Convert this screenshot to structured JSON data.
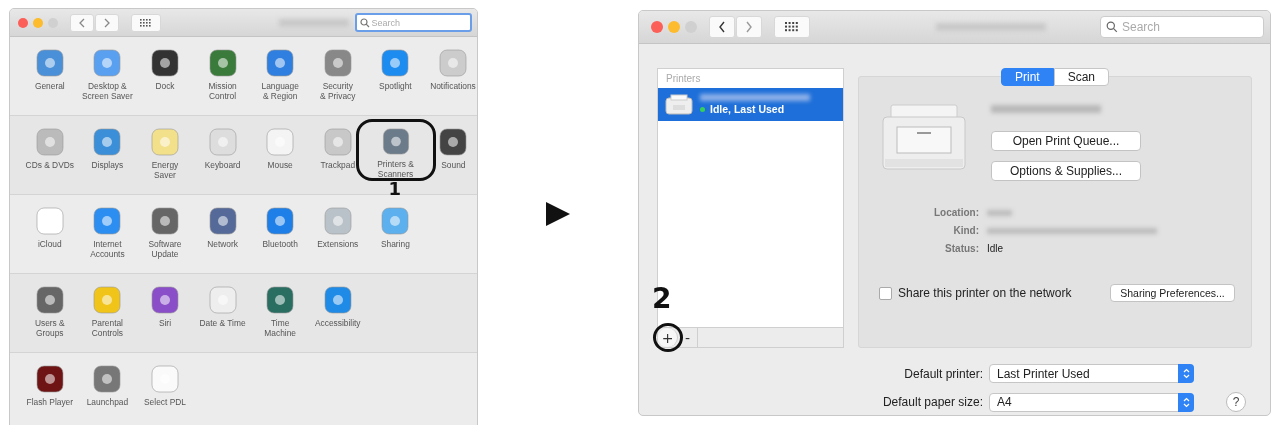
{
  "system_preferences": {
    "search": {
      "placeholder": "Search",
      "focused": true
    },
    "sections": [
      {
        "items": [
          {
            "label": "General",
            "highlighted": false
          },
          {
            "label": "Desktop &\nScreen Saver",
            "highlighted": false
          },
          {
            "label": "Dock",
            "highlighted": false
          },
          {
            "label": "Mission\nControl",
            "highlighted": false
          },
          {
            "label": "Language\n& Region",
            "highlighted": false
          },
          {
            "label": "Security\n& Privacy",
            "highlighted": false
          },
          {
            "label": "Spotlight",
            "highlighted": false
          },
          {
            "label": "Notifications",
            "highlighted": false
          }
        ]
      },
      {
        "items": [
          {
            "label": "CDs & DVDs",
            "highlighted": false
          },
          {
            "label": "Displays",
            "highlighted": false
          },
          {
            "label": "Energy\nSaver",
            "highlighted": false
          },
          {
            "label": "Keyboard",
            "highlighted": false
          },
          {
            "label": "Mouse",
            "highlighted": false
          },
          {
            "label": "Trackpad",
            "highlighted": false
          },
          {
            "label": "Printers &\nScanners",
            "highlighted": true,
            "callout": "1"
          },
          {
            "label": "Sound",
            "highlighted": false
          }
        ]
      },
      {
        "items": [
          {
            "label": "iCloud",
            "highlighted": false
          },
          {
            "label": "Internet\nAccounts",
            "highlighted": false
          },
          {
            "label": "Software\nUpdate",
            "highlighted": false
          },
          {
            "label": "Network",
            "highlighted": false
          },
          {
            "label": "Bluetooth",
            "highlighted": false
          },
          {
            "label": "Extensions",
            "highlighted": false
          },
          {
            "label": "Sharing",
            "highlighted": false
          }
        ]
      },
      {
        "items": [
          {
            "label": "Users &\nGroups",
            "highlighted": false
          },
          {
            "label": "Parental\nControls",
            "highlighted": false
          },
          {
            "label": "Siri",
            "highlighted": false
          },
          {
            "label": "Date & Time",
            "highlighted": false
          },
          {
            "label": "Time\nMachine",
            "highlighted": false
          },
          {
            "label": "Accessibility",
            "highlighted": false
          }
        ]
      },
      {
        "items": [
          {
            "label": "Flash Player",
            "highlighted": false
          },
          {
            "label": "Launchpad",
            "highlighted": false
          },
          {
            "label": "Select PDL",
            "highlighted": false
          }
        ]
      }
    ]
  },
  "printers_and_scanners": {
    "search": {
      "placeholder": "Search",
      "focused": false
    },
    "printers_list": {
      "header": "Printers",
      "printers": [
        {
          "status": "Idle, Last Used",
          "selected": true
        }
      ]
    },
    "add_button": {
      "label": "+",
      "highlighted": true,
      "callout": "2"
    },
    "remove_button": {
      "label": "-"
    },
    "tabs": [
      {
        "label": "Print",
        "selected": true
      },
      {
        "label": "Scan",
        "selected": false
      }
    ],
    "buttons": [
      "Open Print Queue...",
      "Options & Supplies..."
    ],
    "info": [
      {
        "label": "Location:"
      },
      {
        "label": "Kind:"
      },
      {
        "label": "Status:",
        "value": "Idle"
      }
    ],
    "share": {
      "label": "Share this printer on the network",
      "checked": false
    },
    "sharing_button": "Sharing Preferences...",
    "defaults": [
      {
        "label": "Default printer:",
        "value": "Last Printer Used"
      },
      {
        "label": "Default paper size:",
        "value": "A4"
      }
    ],
    "help": "?"
  }
}
